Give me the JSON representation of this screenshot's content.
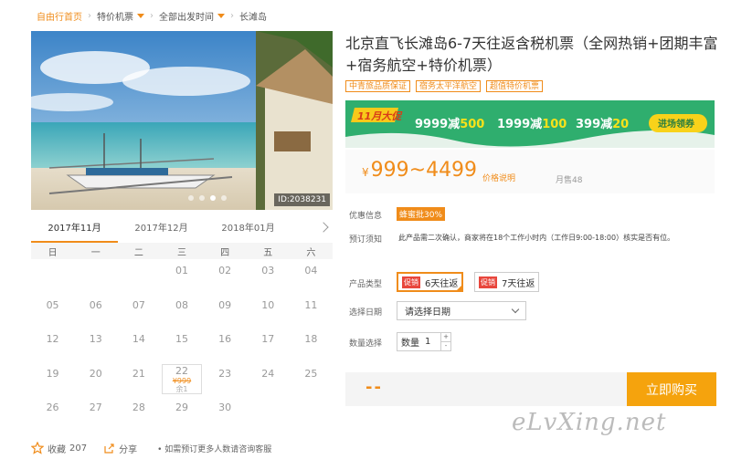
{
  "breadcrumb": {
    "home": "自由行首页",
    "items": [
      "特价机票",
      "全部出发时间",
      "长滩岛"
    ]
  },
  "photo": {
    "id_label": "ID:2038231"
  },
  "calendar": {
    "months": [
      "2017年11月",
      "2017年12月",
      "2018年01月"
    ],
    "weekdays": [
      "日",
      "一",
      "二",
      "三",
      "四",
      "五",
      "六"
    ],
    "rows": [
      [
        "",
        "",
        "",
        "01",
        "02",
        "03",
        "04"
      ],
      [
        "05",
        "06",
        "07",
        "08",
        "09",
        "10",
        "11"
      ],
      [
        "12",
        "13",
        "14",
        "15",
        "16",
        "17",
        "18"
      ],
      [
        "19",
        "20",
        "21",
        "22",
        "23",
        "24",
        "25"
      ],
      [
        "26",
        "27",
        "28",
        "29",
        "30",
        "",
        ""
      ]
    ],
    "selected_day": {
      "date": "22",
      "price": "¥999",
      "remaining": "余1"
    }
  },
  "bottom": {
    "fav_label": "收藏",
    "fav_count": "207",
    "share_label": "分享",
    "tip": "如需预订更多人数请咨询客服"
  },
  "product": {
    "title": "北京直飞长滩岛6-7天往返含税机票（全网热销+团期丰富+宿务航空+特价机票）",
    "tags": [
      "中青旅品质保证",
      "宿务太平洋航空",
      "超值特价机票"
    ],
    "promo": {
      "badge": "11月大促",
      "deals": [
        {
          "a": "9999减",
          "b": "500"
        },
        {
          "a": "1999减",
          "b": "100"
        },
        {
          "a": "399减",
          "b": "20"
        }
      ],
      "button": "进场领券"
    },
    "price": {
      "currency": "¥",
      "range": "999~4499",
      "note": "价格说明",
      "sold": "月售48"
    },
    "discount": {
      "label": "优惠信息",
      "badge": "蜂蜜批30%"
    },
    "notice": {
      "label": "预订须知",
      "text": "此产品需二次确认，商家将在18个工作小时内（工作日9:00-18:00）核实是否有位。"
    },
    "type": {
      "label": "产品类型",
      "badge": "促销",
      "options": [
        "6天往返",
        "7天往返"
      ]
    },
    "date": {
      "label": "选择日期",
      "value": "请选择日期"
    },
    "qty": {
      "label": "数量选择",
      "field_label": "数量",
      "value": "1",
      "up": "+",
      "down": "-"
    },
    "buy": {
      "dashes": "--",
      "button": "立即购买"
    }
  },
  "watermark": "eLvXing.net",
  "colors": {
    "accent": "#f08c1a",
    "promo_green": "#2fae6e",
    "buy": "#f5a30d"
  }
}
